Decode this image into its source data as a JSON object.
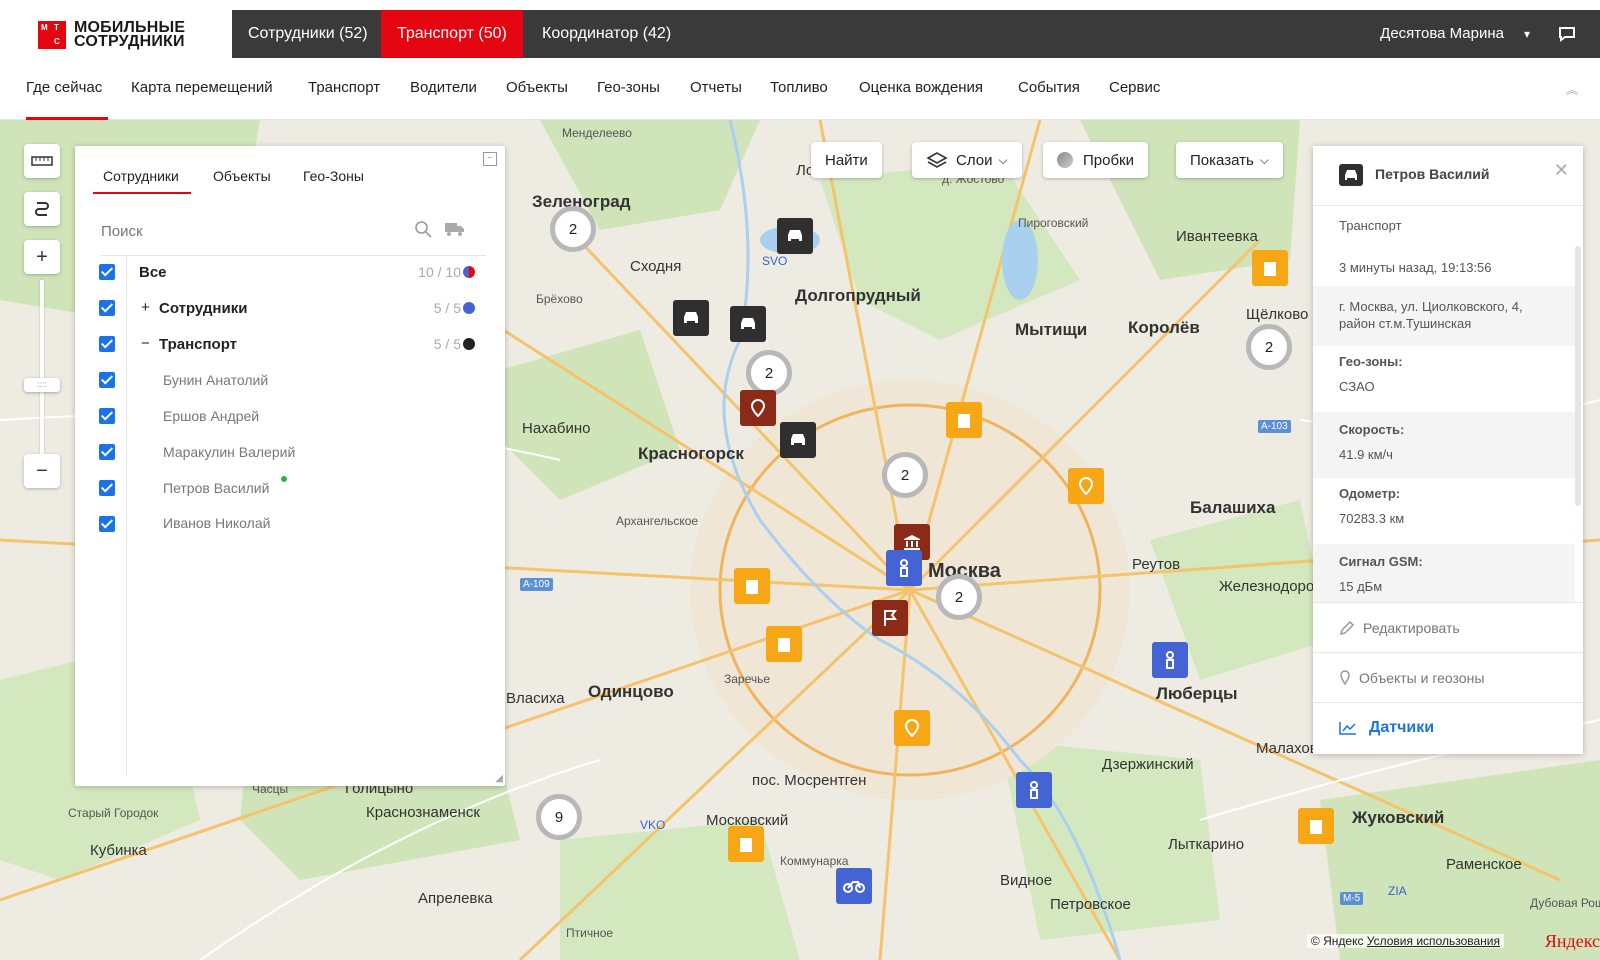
{
  "brand": {
    "line1": "МОБИЛЬНЫЕ",
    "line2": "СОТРУДНИКИ",
    "mark": "МТС"
  },
  "top_tabs": [
    "Сотрудники (52)",
    "Транспорт (50)",
    "Координатор (42)"
  ],
  "user": {
    "name": "Десятова Марина",
    "chevron": "⌄"
  },
  "nav": [
    "Где сейчас",
    "Карта перемещений",
    "Транспорт",
    "Водители",
    "Объекты",
    "Гео-зоны",
    "Отчеты",
    "Топливо",
    "Оценка вождения",
    "События",
    "Сервис"
  ],
  "map_buttons": {
    "find": "Найти",
    "layers": "Слои",
    "traffic": "Пробки",
    "show": "Показать"
  },
  "left_panel": {
    "tabs": [
      "Сотрудники",
      "Объекты",
      "Гео-Зоны"
    ],
    "search_placeholder": "Поиск",
    "all": {
      "label": "Все",
      "count": "10 / 10"
    },
    "groups": [
      {
        "prefix": "+",
        "label": "Сотрудники",
        "count": "5 / 5",
        "color": "#4564d4"
      },
      {
        "prefix": "−",
        "label": "Транспорт",
        "count": "5 / 5",
        "color": "#222222"
      }
    ],
    "items": [
      "Бунин Анатолий",
      "Ершов Андрей",
      "Маракулин Валерий",
      "Петров Василий",
      "Иванов Николай"
    ]
  },
  "right_panel": {
    "name": "Петров Василий",
    "type": "Транспорт",
    "time": "3 минуты назад, 19:13:56",
    "address": "г. Москва, ул. Циолковского, 4, район ст.м.Тушинская",
    "geo_label": "Гео-зоны:",
    "geo_value": "СЗАО",
    "speed_label": "Скорость:",
    "speed_value": "41.9 км/ч",
    "odometer_label": "Одометр:",
    "odometer_value": "70283.3 км",
    "gsm_label": "Сигнал GSM:",
    "gsm_value": "15 дБм",
    "actions": [
      "Редактировать",
      "Объекты и геозоны",
      "Датчики"
    ]
  },
  "places": [
    {
      "t": "Менделеево"
    },
    {
      "t": "Зеленоград"
    },
    {
      "t": "Лобня"
    },
    {
      "t": "Сходня"
    },
    {
      "t": "Брёхово"
    },
    {
      "t": "Долгопрудный"
    },
    {
      "t": "Мытищи"
    },
    {
      "t": "Королёв"
    },
    {
      "t": "Ивантеевка"
    },
    {
      "t": "Щёлково"
    },
    {
      "t": "Пироговский"
    },
    {
      "t": "Нахабино"
    },
    {
      "t": "Красногорск"
    },
    {
      "t": "Архангельское"
    },
    {
      "t": "Балашиха"
    },
    {
      "t": "Реутов"
    },
    {
      "t": "Железнодорожный"
    },
    {
      "t": "Москва"
    },
    {
      "t": "Одинцово"
    },
    {
      "t": "Власиха"
    },
    {
      "t": "Заречье"
    },
    {
      "t": "Люберцы"
    },
    {
      "t": "Малаховка"
    },
    {
      "t": "Дзержинский"
    },
    {
      "t": "пос. Мосрентген"
    },
    {
      "t": "Голицыно"
    },
    {
      "t": "Часцы"
    },
    {
      "t": "Краснознаменск"
    },
    {
      "t": "Старый Городок"
    },
    {
      "t": "Кубинка"
    },
    {
      "t": "Московский"
    },
    {
      "t": "Коммунарка"
    },
    {
      "t": "Видное"
    },
    {
      "t": "Лыткарино"
    },
    {
      "t": "Жуковский"
    },
    {
      "t": "Раменское"
    },
    {
      "t": "Петровское"
    },
    {
      "t": "Апрелевка"
    },
    {
      "t": "Дубовая Роща"
    },
    {
      "t": "Птичное"
    },
    {
      "t": "д. Жостово"
    },
    {
      "t": "Мытищи"
    }
  ],
  "clusters": [
    "2",
    "2",
    "2",
    "2",
    "2",
    "9"
  ],
  "road_badges": [
    "A-103",
    "A-109",
    "M-5"
  ],
  "airports": [
    "SVO",
    "VKO",
    "ZIA"
  ],
  "copyright": {
    "text": "© Яндекс",
    "link": "Условия использования",
    "brand": "Яндекс"
  },
  "colors": {
    "accent": "#e30611",
    "dark": "#3a3a3a",
    "employee_blue": "#4564d4",
    "transport_dark": "#2f2f2f",
    "object_yellow": "#f7a716"
  }
}
